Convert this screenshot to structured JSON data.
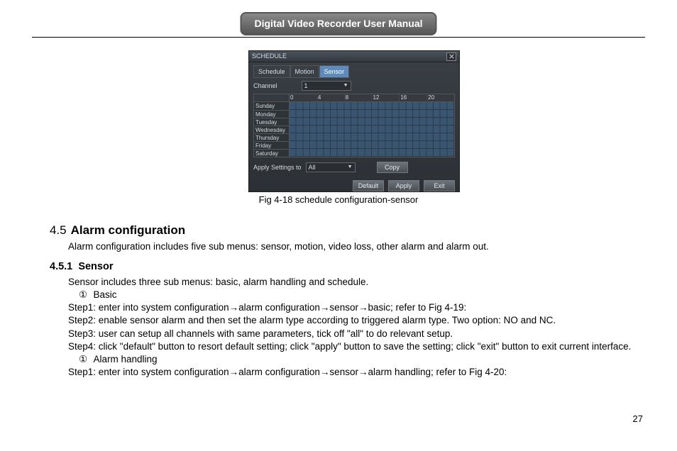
{
  "header": {
    "title": "Digital Video Recorder User Manual"
  },
  "window": {
    "title": "SCHEDULE",
    "close_label": "×",
    "tabs": [
      "Schedule",
      "Motion",
      "Sensor"
    ],
    "active_tab": 2,
    "channel_label": "Channel",
    "channel_value": "1",
    "hours": [
      "0",
      "4",
      "8",
      "12",
      "16",
      "20"
    ],
    "days": [
      "Sunday",
      "Monday",
      "Tuesday",
      "Wednesday",
      "Thursday",
      "Friday",
      "Saturday"
    ],
    "apply_label": "Apply Settings to",
    "apply_value": "All",
    "copy_label": "Copy",
    "buttons": {
      "default": "Default",
      "apply": "Apply",
      "exit": "Exit"
    }
  },
  "caption": "Fig 4-18 schedule configuration-sensor",
  "section45": {
    "num": "4.5",
    "title": "Alarm configuration",
    "intro": "Alarm configuration includes five sub menus: sensor, motion, video loss, other alarm and alarm out."
  },
  "section451": {
    "num": "4.5.1",
    "title": "Sensor",
    "intro": "Sensor includes three sub menus: basic, alarm handling and schedule.",
    "item1_mark": "①",
    "item1_label": "Basic",
    "step1": "Step1: enter into system configuration→alarm configuration→sensor→basic; refer to Fig 4-19:",
    "step2": "Step2: enable sensor alarm and then set the alarm type according to triggered alarm type. Two option: NO and NC.",
    "step3": "Step3: user can setup all channels with same parameters, tick off \"all\" to do relevant setup.",
    "step4": "Step4: click \"default\" button to resort default setting; click \"apply\" button to save the setting; click \"exit\" button to exit current interface.",
    "item2_mark": "①",
    "item2_label": "Alarm handling",
    "step1b": "Step1: enter into system configuration→alarm configuration→sensor→alarm handling; refer to Fig 4-20:"
  },
  "page_number": "27"
}
